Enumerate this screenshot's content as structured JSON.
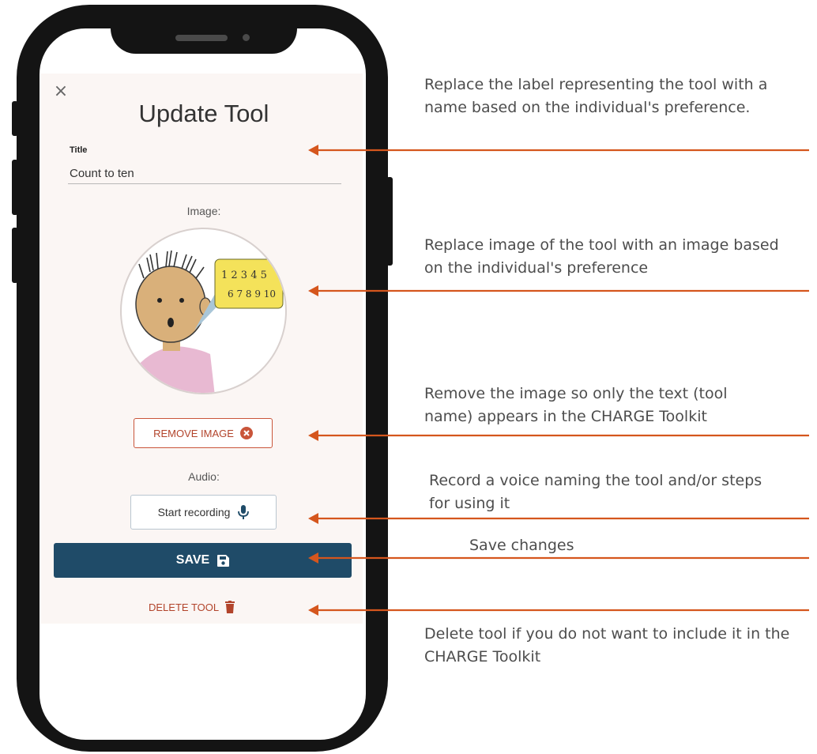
{
  "app": {
    "dialog_title": "Update Tool",
    "close_glyph": "×"
  },
  "form": {
    "title_label": "Title",
    "title_value": "Count to ten",
    "image_label": "Image:",
    "audio_label": "Audio:",
    "remove_image_label": "REMOVE IMAGE",
    "record_label": "Start recording",
    "save_label": "SAVE",
    "delete_label": "DELETE TOOL"
  },
  "illustration": {
    "numbers_row1": "1 2 3 4 5",
    "numbers_row2": "6 7 8 9 10"
  },
  "annotations": [
    {
      "text": "Replace the label representing the tool with a name based on the individual's preference."
    },
    {
      "text": "Replace image of the tool with an image based on the individual's preference"
    },
    {
      "text": "Remove the image so only the text (tool name) appears in the CHARGE Toolkit"
    },
    {
      "text": "Record a voice naming the tool and/or steps for using it"
    },
    {
      "text": "Save changes"
    },
    {
      "text": "Delete tool if you do not want to include it in the CHARGE Toolkit"
    }
  ],
  "colors": {
    "arrow": "#d5561d",
    "save_button": "#1f4b68",
    "danger": "#b2442b",
    "phone_frame": "#141414",
    "dialog_bg": "#fbf6f4"
  },
  "icons": [
    "close-icon",
    "remove-circle-icon",
    "microphone-icon",
    "floppy-disk-icon",
    "trash-icon"
  ]
}
